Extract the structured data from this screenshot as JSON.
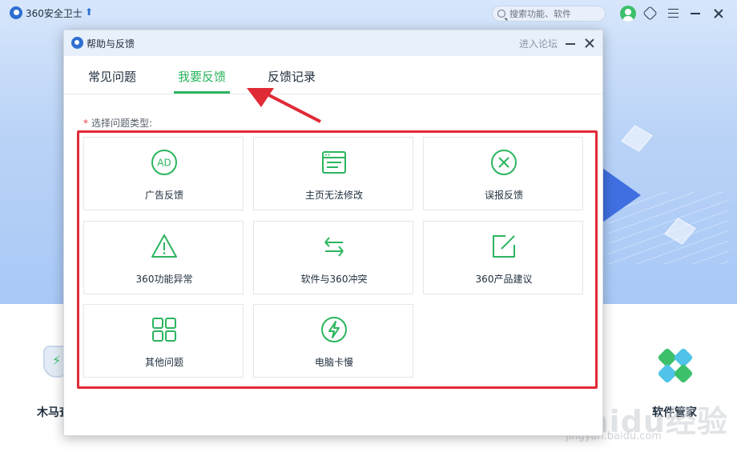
{
  "app": {
    "title": "360安全卫士",
    "search_placeholder": "搜索功能、软件",
    "tool_left_label": "木马查",
    "tool_right_label": "软件管家"
  },
  "watermark": {
    "main": "Baidu经验",
    "sub": "jingyan.baidu.com"
  },
  "dialog": {
    "title": "帮助与反馈",
    "forum_link": "进入论坛",
    "tabs": [
      {
        "label": "常见问题",
        "active": false
      },
      {
        "label": "我要反馈",
        "active": true
      },
      {
        "label": "反馈记录",
        "active": false
      }
    ],
    "prompt_star": "*",
    "prompt": "选择问题类型:",
    "categories": [
      {
        "label": "广告反馈",
        "icon": "ad-icon"
      },
      {
        "label": "主页无法修改",
        "icon": "browser-page-icon"
      },
      {
        "label": "误报反馈",
        "icon": "close-circle-icon"
      },
      {
        "label": "360功能异常",
        "icon": "warning-icon"
      },
      {
        "label": "软件与360冲突",
        "icon": "swap-arrows-icon"
      },
      {
        "label": "360产品建议",
        "icon": "edit-icon"
      },
      {
        "label": "其他问题",
        "icon": "grid-apps-icon"
      },
      {
        "label": "电脑卡慢",
        "icon": "lightning-icon"
      }
    ]
  },
  "colors": {
    "accent_green": "#2bb55e",
    "highlight_red": "#e02a36",
    "brand_blue": "#2e6fd1"
  }
}
